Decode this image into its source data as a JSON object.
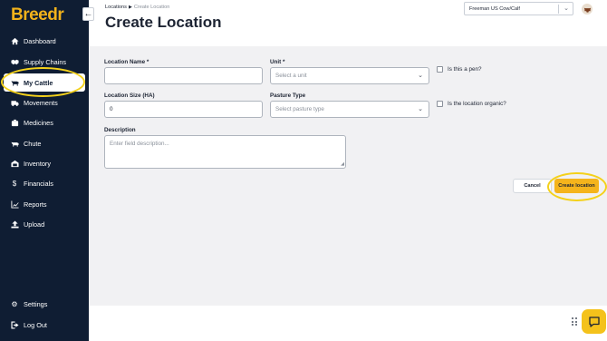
{
  "app": {
    "logo": "Breedr"
  },
  "sidebar": {
    "items": [
      {
        "label": "Dashboard",
        "icon": "home-icon"
      },
      {
        "label": "Supply Chains",
        "icon": "handshake-icon"
      },
      {
        "label": "My Cattle",
        "icon": "cow-icon",
        "active": true
      },
      {
        "label": "Movements",
        "icon": "truck-icon"
      },
      {
        "label": "Medicines",
        "icon": "medicine-icon"
      },
      {
        "label": "Chute",
        "icon": "chute-icon"
      },
      {
        "label": "Inventory",
        "icon": "inventory-icon"
      },
      {
        "label": "Financials",
        "icon": "dollar-icon"
      },
      {
        "label": "Reports",
        "icon": "chart-icon"
      },
      {
        "label": "Upload",
        "icon": "upload-icon"
      }
    ],
    "bottom": [
      {
        "label": "Settings",
        "icon": "gear-icon"
      },
      {
        "label": "Log Out",
        "icon": "logout-icon"
      }
    ]
  },
  "header": {
    "breadcrumb_parent": "Locations",
    "breadcrumb_sep": "▶",
    "breadcrumb_current": "Create Location",
    "title": "Create Location",
    "org_select_value": "Freeman US Cow/Calf"
  },
  "form": {
    "location_name": {
      "label": "Location Name *",
      "value": ""
    },
    "unit": {
      "label": "Unit *",
      "placeholder": "Select a unit"
    },
    "is_pen": {
      "label": "Is this a pen?",
      "checked": false
    },
    "location_size": {
      "label": "Location Size (HA)",
      "value": "0"
    },
    "pasture_type": {
      "label": "Pasture Type",
      "placeholder": "Select pasture type"
    },
    "is_organic": {
      "label": "Is the location organic?",
      "checked": false
    },
    "description": {
      "label": "Description",
      "placeholder": "Enter field description..."
    }
  },
  "actions": {
    "cancel_label": "Cancel",
    "create_label": "Create location"
  },
  "colors": {
    "sidebar_bg": "#0f1d33",
    "accent": "#f5b41c",
    "annotation_ring": "#f4d11b",
    "panel_bg": "#f1f1f3"
  }
}
